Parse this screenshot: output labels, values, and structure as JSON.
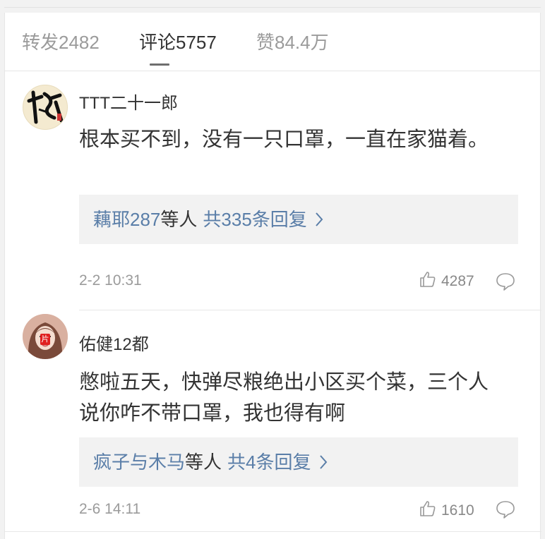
{
  "tabs": [
    {
      "label": "转发2482",
      "active": false
    },
    {
      "label": "评论5757",
      "active": true
    },
    {
      "label": "赞84.4万",
      "active": false
    }
  ],
  "comments": [
    {
      "username": "TTT二十一郎",
      "avatar_icon": "calligraphy-avatar-icon",
      "text": "根本买不到，没有一只口罩，一直在家猫着。",
      "reply_users": "藕耶287",
      "reply_etc": "等人",
      "reply_total": "共335条回复",
      "time": "2-2 10:31",
      "likes": "4287"
    },
    {
      "username": "佑健12都",
      "avatar_icon": "girl-photo-avatar-icon",
      "avatar_badge": "片",
      "text": "憋啦五天，快弹尽粮绝出小区买个菜，三个人说你咋不带口罩，我也得有啊",
      "reply_users": "疯子与木马",
      "reply_etc": "等人",
      "reply_total": "共4条回复",
      "time": "2-6 14:11",
      "likes": "1610"
    }
  ],
  "colors": {
    "link": "#5a7ea8",
    "text": "#333333",
    "muted": "#9b9b9b",
    "reply_bg": "#f2f2f2"
  }
}
